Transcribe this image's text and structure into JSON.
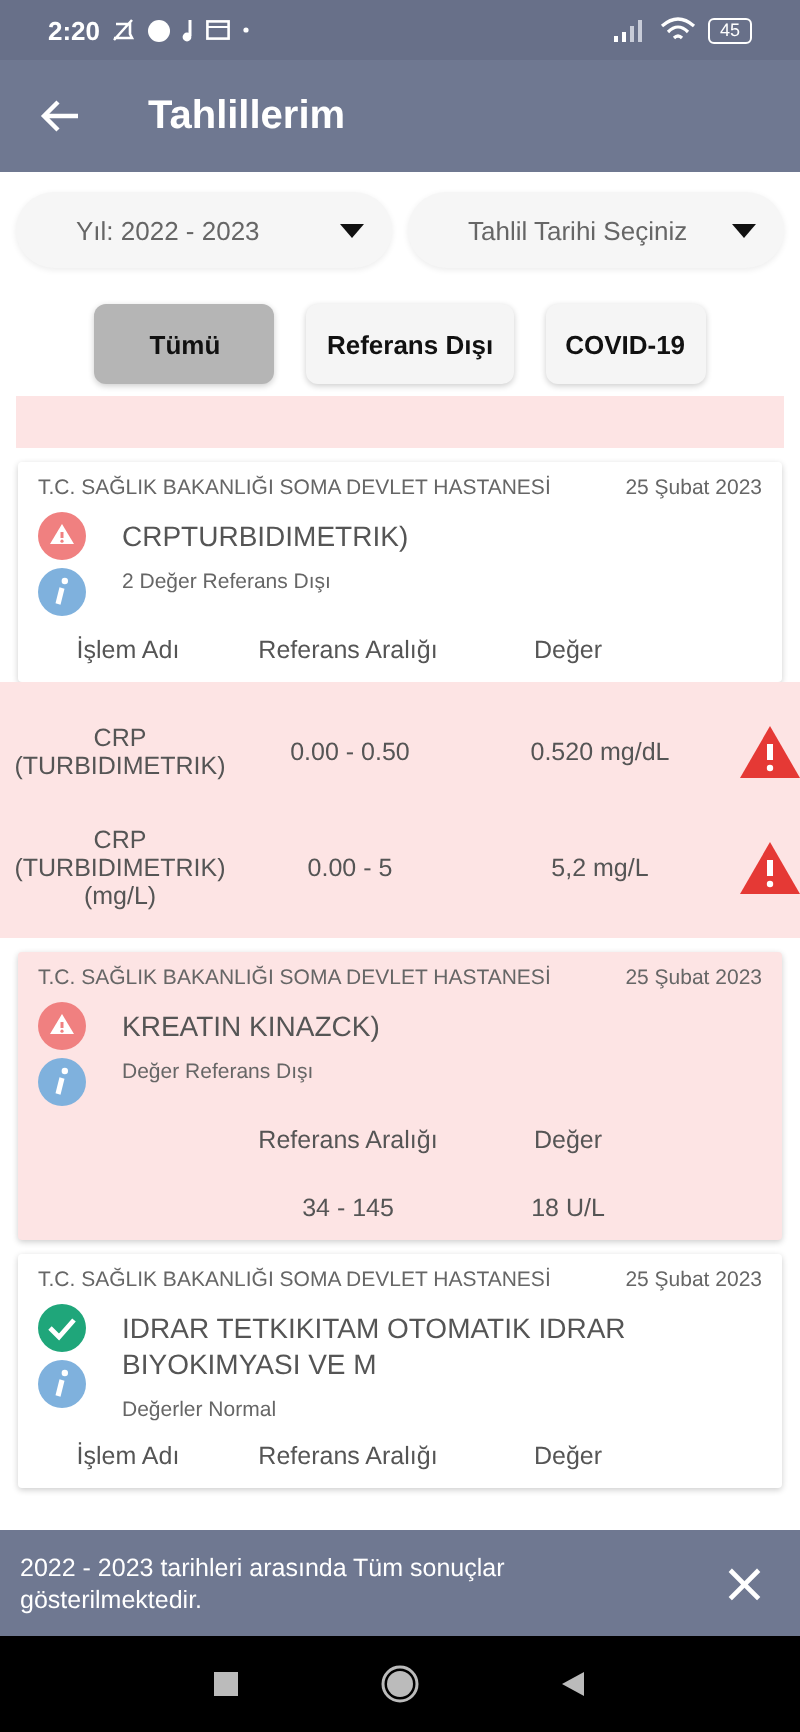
{
  "status_bar": {
    "time": "2:20",
    "battery": "45"
  },
  "app_bar": {
    "title": "Tahlillerim"
  },
  "dropdowns": [
    {
      "label": "Yıl: 2022 - 2023"
    },
    {
      "label": "Tahlil Tarihi Seçiniz"
    }
  ],
  "filters": [
    {
      "label": "Tümü",
      "selected": true
    },
    {
      "label": "Referans Dışı",
      "selected": false
    },
    {
      "label": "COVID-19",
      "selected": false
    }
  ],
  "results": [
    {
      "hospital": "T.C. SAĞLIK BAKANLIĞI SOMA DEVLET HASTANESİ",
      "date": "25 Şubat 2023",
      "kind": "abnormal",
      "highlighted": false,
      "title": "CRPTURBIDIMETRIK)",
      "summary": "2 Değer Referans Dışı",
      "headers": [
        {
          "kind": "name",
          "label": "İşlem Adı"
        },
        {
          "kind": "range",
          "label": "Referans Aralığı"
        },
        {
          "kind": "value",
          "label": "Değer"
        }
      ],
      "rows": [
        {
          "name": "CRP (TURBIDIMETRIK)",
          "range": "0.00 - 0.50",
          "value": "0.520 mg/dL"
        },
        {
          "name": "CRP (TURBIDIMETRIK) (mg/L)",
          "range": "0.00 - 5",
          "value": "5,2 mg/L"
        }
      ]
    },
    {
      "hospital": "T.C. SAĞLIK BAKANLIĞI SOMA DEVLET HASTANESİ",
      "date": "25 Şubat 2023",
      "kind": "abnormal",
      "highlighted": true,
      "title": "KREATIN KINAZCK)",
      "summary": "Değer Referans Dışı",
      "headers": [
        {
          "kind": "range",
          "label": "Referans Aralığı"
        },
        {
          "kind": "value",
          "label": "Değer"
        }
      ],
      "rows": [
        {
          "range": "34 - 145",
          "value": "18 U/L"
        }
      ]
    },
    {
      "hospital": "T.C. SAĞLIK BAKANLIĞI SOMA DEVLET HASTANESİ",
      "date": "25 Şubat 2023",
      "kind": "normal",
      "highlighted": false,
      "title": "IDRAR TETKIKITAM OTOMATIK IDRAR BIYOKIMYASI VE M",
      "summary": "Değerler Normal",
      "headers": [
        {
          "kind": "name",
          "label": "İşlem Adı"
        },
        {
          "kind": "range",
          "label": "Referans Aralığı"
        },
        {
          "kind": "value",
          "label": "Değer"
        }
      ]
    }
  ],
  "snackbar": {
    "message": "2022 - 2023 tarihleri arasında Tüm sonuçlar gösterilmektedir.",
    "close": "×"
  }
}
